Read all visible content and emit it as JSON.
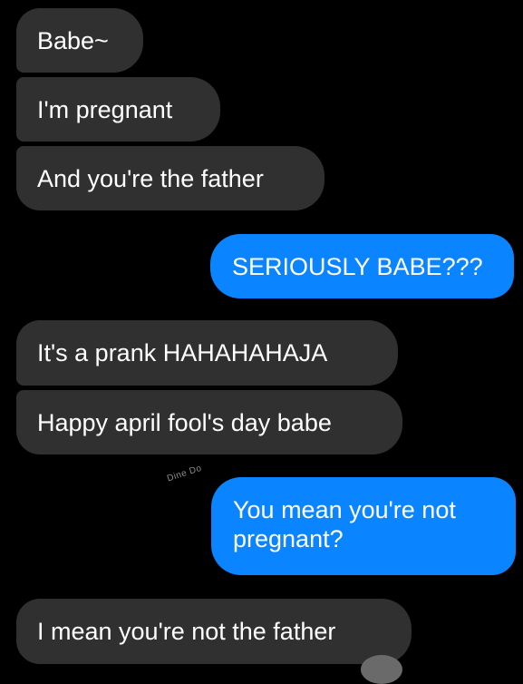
{
  "conversation": {
    "messages": [
      {
        "sender": "them",
        "text": "Babe~"
      },
      {
        "sender": "them",
        "text": "I'm pregnant"
      },
      {
        "sender": "them",
        "text": "And you're the father"
      },
      {
        "sender": "me",
        "text": "SERIOUSLY BABE???"
      },
      {
        "sender": "them",
        "text": "It's a prank HAHAHAHAJA"
      },
      {
        "sender": "them",
        "text": "Happy april fool's day babe"
      },
      {
        "sender": "me",
        "text": "You mean you're not pregnant?"
      },
      {
        "sender": "them",
        "text": "I mean you're not the father"
      }
    ],
    "watermark": "Dine Do"
  },
  "colors": {
    "background": "#000000",
    "received_bubble": "#303030",
    "sent_bubble": "#0a84ff",
    "text": "#ffffff"
  }
}
